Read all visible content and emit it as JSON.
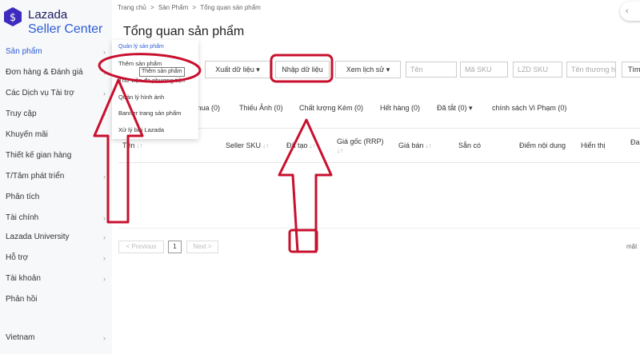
{
  "logo": {
    "line1": "Lazada",
    "line2": "Seller Center"
  },
  "sidebar": {
    "items": [
      {
        "label": "Sản phẩm",
        "chevron": true
      },
      {
        "label": "Đơn hàng & Đánh giá",
        "chevron": true
      },
      {
        "label": "Các Dịch vụ Tài trợ",
        "chevron": true
      },
      {
        "label": "Truy cập",
        "chevron": true
      },
      {
        "label": "Khuyến mãi",
        "chevron": false
      },
      {
        "label": "Thiết kế gian hàng",
        "chevron": false
      },
      {
        "label": "T/Tâm phát triển",
        "chevron": true
      },
      {
        "label": "Phân tích",
        "chevron": false
      },
      {
        "label": "Tài chính",
        "chevron": true
      },
      {
        "label": "Lazada University",
        "chevron": true
      },
      {
        "label": "Hỗ trợ",
        "chevron": true
      },
      {
        "label": "Tài khoản",
        "chevron": true
      },
      {
        "label": "Phản hồi",
        "chevron": false
      }
    ],
    "country": "Vietnam"
  },
  "breadcrumb": [
    "Trang chủ",
    ">",
    "Sản Phẩm",
    ">",
    "Tổng quan sản phẩm"
  ],
  "page_title": "Tổng quan sản phẩm",
  "toolbar": {
    "export": "Xuất dữ liệu",
    "import": "Nhập dữ liệu",
    "history": "Xem lịch sử",
    "caret": "▾"
  },
  "search": {
    "name": "Tên",
    "sku": "Mã SKU",
    "lzd_sku": "LZD SKU",
    "brand": "Tên thương h",
    "find": "Tìm"
  },
  "filters": {
    "f1": "mua (0)",
    "f2": "Thiếu Ảnh (0)",
    "f3": "Chất lượng Kém (0)",
    "f4": "Hết hàng (0)",
    "f5": "Đã tắt (0)",
    "f6": "chính sách Vi Phạm (0)",
    "caret": "▾"
  },
  "table": {
    "columns": {
      "name": "Tên",
      "seller_sku": "Seller SKU",
      "created": "Đã tạo",
      "rrp_1": "Giá gốc (RRP)",
      "rrp_2": "↓↑",
      "price": "Giá bán",
      "stock": "Sẵn có",
      "content_score": "Điểm nội dung",
      "visible": "Hiển thị",
      "more": "Đa"
    },
    "sort_glyph": "↓↑"
  },
  "pagination": {
    "prev": "< Previous",
    "current": "1",
    "next": "Next >",
    "per_page": "mặt"
  },
  "dropdown": {
    "header": "Quản lý sản phẩm",
    "items": [
      "Thêm sản phẩm",
      "Thư viện đa phương tiện",
      "Quản lý hình ảnh",
      "Banner trang sản phẩm",
      "Xử lý bởi Lazada"
    ],
    "tooltip": "Thêm sản phẩm"
  },
  "colors": {
    "annotation": "#c8102e",
    "accent": "#2b5cd6",
    "logo_mark": "#3d2bbf"
  },
  "icons": {
    "top_button": "chevron-left-icon",
    "chevron": "chevron-right-icon"
  }
}
